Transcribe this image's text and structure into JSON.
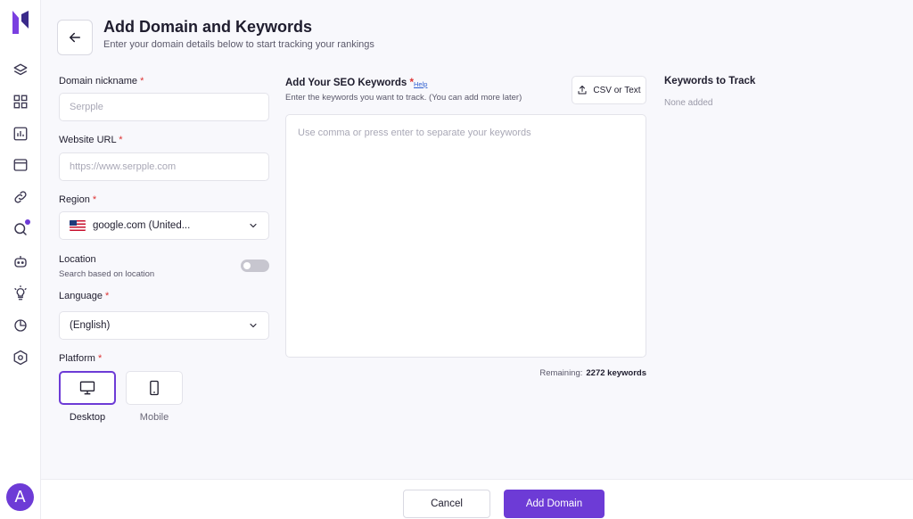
{
  "header": {
    "title": "Add Domain and Keywords",
    "subtitle": "Enter your domain details below to start tracking your rankings"
  },
  "sidebar": {
    "icons": [
      "layers-icon",
      "grid-icon",
      "bar-chart-icon",
      "browser-icon",
      "link-icon",
      "search-icon",
      "robot-icon",
      "lightbulb-icon",
      "chart-pie-icon",
      "hexagon-settings-icon"
    ],
    "avatar_letter": "A",
    "accent": "#6d3bd6"
  },
  "form": {
    "nickname": {
      "label": "Domain nickname",
      "required": "*",
      "placeholder": "Serpple"
    },
    "url": {
      "label": "Website URL",
      "required": "*",
      "placeholder": "https://www.serpple.com"
    },
    "region": {
      "label": "Region",
      "required": "*",
      "value": "google.com (United..."
    },
    "location": {
      "label": "Location",
      "hint": "Search based on location"
    },
    "language": {
      "label": "Language",
      "required": "*",
      "value": "(English)"
    },
    "platform": {
      "label": "Platform",
      "required": "*",
      "desktop": "Desktop",
      "mobile": "Mobile"
    }
  },
  "keywords": {
    "title": "Add Your SEO Keywords",
    "required": "*",
    "help": "Help",
    "subtitle": "Enter the keywords you want to track. (You can add more later)",
    "csv_button": "CSV or Text",
    "placeholder": "Use comma or press enter to separate your keywords",
    "remaining_label": "Remaining:",
    "remaining_value": "2272 keywords"
  },
  "track": {
    "title": "Keywords to Track",
    "empty": "None added"
  },
  "footer": {
    "cancel": "Cancel",
    "submit": "Add Domain"
  }
}
